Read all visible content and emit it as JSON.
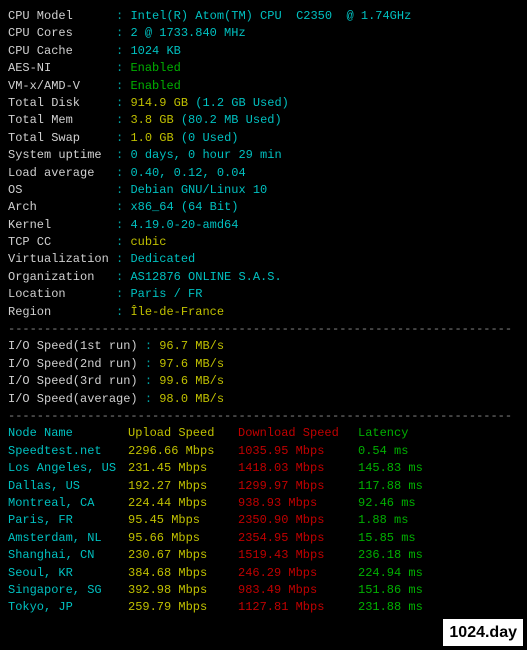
{
  "info": [
    {
      "k": "CPU Model",
      "v": "Intel(R) Atom(TM) CPU  C2350  @ 1.74GHz",
      "cls": "cyan"
    },
    {
      "k": "CPU Cores",
      "v_parts": [
        {
          "t": "2",
          "cls": "cyan"
        },
        {
          "t": " @ 1733.840 MHz",
          "cls": "cyan"
        }
      ]
    },
    {
      "k": "CPU Cache",
      "v": "1024 KB",
      "cls": "cyan"
    },
    {
      "k": "AES-NI",
      "v": "Enabled",
      "cls": "green"
    },
    {
      "k": "VM-x/AMD-V",
      "v": "Enabled",
      "cls": "green"
    },
    {
      "k": "Total Disk",
      "v_parts": [
        {
          "t": "914.9 GB ",
          "cls": "yellow"
        },
        {
          "t": "(1.2 GB Used)",
          "cls": "cyan"
        }
      ]
    },
    {
      "k": "Total Mem",
      "v_parts": [
        {
          "t": "3.8 GB ",
          "cls": "yellow"
        },
        {
          "t": "(80.2 MB Used)",
          "cls": "cyan"
        }
      ]
    },
    {
      "k": "Total Swap",
      "v_parts": [
        {
          "t": "1.0 GB ",
          "cls": "yellow"
        },
        {
          "t": "(0 Used)",
          "cls": "cyan"
        }
      ]
    },
    {
      "k": "System uptime",
      "v": "0 days, 0 hour 29 min",
      "cls": "cyan"
    },
    {
      "k": "Load average",
      "v": "0.40, 0.12, 0.04",
      "cls": "cyan"
    },
    {
      "k": "OS",
      "v": "Debian GNU/Linux 10",
      "cls": "cyan"
    },
    {
      "k": "Arch",
      "v": "x86_64 (64 Bit)",
      "cls": "cyan"
    },
    {
      "k": "Kernel",
      "v": "4.19.0-20-amd64",
      "cls": "cyan"
    },
    {
      "k": "TCP CC",
      "v": "cubic",
      "cls": "yellow"
    },
    {
      "k": "Virtualization",
      "v": "Dedicated",
      "cls": "cyan"
    },
    {
      "k": "Organization",
      "v": "AS12876 ONLINE S.A.S.",
      "cls": "cyan"
    },
    {
      "k": "Location",
      "v": "Paris / FR",
      "cls": "cyan"
    },
    {
      "k": "Region",
      "v": "Île-de-France",
      "cls": "yellow"
    }
  ],
  "io": [
    {
      "k": "I/O Speed(1st run)",
      "v": "96.7 MB/s"
    },
    {
      "k": "I/O Speed(2nd run)",
      "v": "97.6 MB/s"
    },
    {
      "k": "I/O Speed(3rd run)",
      "v": "99.6 MB/s"
    },
    {
      "k": "I/O Speed(average)",
      "v": "98.0 MB/s"
    }
  ],
  "headers": {
    "node": "Node Name",
    "up": "Upload Speed",
    "dn": "Download Speed",
    "lat": "Latency"
  },
  "speed": [
    {
      "node": "Speedtest.net",
      "up": "2296.66 Mbps",
      "dn": "1035.95 Mbps",
      "lat": "0.54 ms"
    },
    {
      "node": "Los Angeles, US",
      "up": "231.45 Mbps",
      "dn": "1418.03 Mbps",
      "lat": "145.83 ms"
    },
    {
      "node": "Dallas, US",
      "up": "192.27 Mbps",
      "dn": "1299.97 Mbps",
      "lat": "117.88 ms"
    },
    {
      "node": "Montreal, CA",
      "up": "224.44 Mbps",
      "dn": "938.93 Mbps",
      "lat": "92.46 ms"
    },
    {
      "node": "Paris, FR",
      "up": "95.45 Mbps",
      "dn": "2350.90 Mbps",
      "lat": "1.88 ms"
    },
    {
      "node": "Amsterdam, NL",
      "up": "95.66 Mbps",
      "dn": "2354.95 Mbps",
      "lat": "15.85 ms"
    },
    {
      "node": "Shanghai, CN",
      "up": "230.67 Mbps",
      "dn": "1519.43 Mbps",
      "lat": "236.18 ms"
    },
    {
      "node": "Seoul, KR",
      "up": "384.68 Mbps",
      "dn": "246.29 Mbps",
      "lat": "224.94 ms"
    },
    {
      "node": "Singapore, SG",
      "up": "392.98 Mbps",
      "dn": "983.49 Mbps",
      "lat": "151.86 ms"
    },
    {
      "node": "Tokyo, JP",
      "up": "259.79 Mbps",
      "dn": "1127.81 Mbps",
      "lat": "231.88 ms"
    }
  ],
  "dashes": "----------------------------------------------------------------------",
  "watermark": "1024.day"
}
